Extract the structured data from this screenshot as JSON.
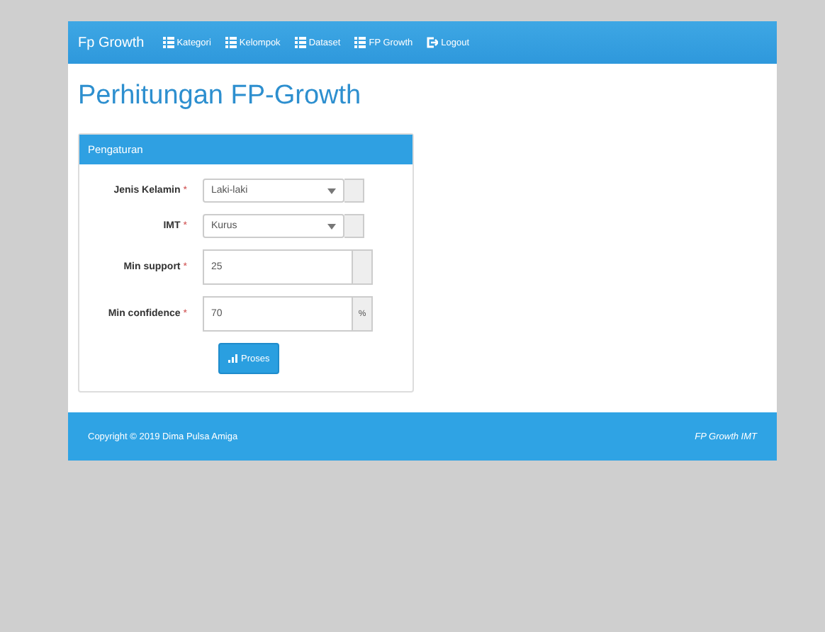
{
  "navbar": {
    "brand": "Fp Growth",
    "items": [
      {
        "label": "Kategori"
      },
      {
        "label": "Kelompok"
      },
      {
        "label": "Dataset"
      },
      {
        "label": "FP Growth"
      },
      {
        "label": "Logout",
        "kind": "logout"
      }
    ]
  },
  "page_title": "Perhitungan FP-Growth",
  "panel": {
    "title": "Pengaturan",
    "fields": [
      {
        "label": "Jenis Kelamin",
        "required": "*",
        "kind": "select",
        "value": "Laki-laki"
      },
      {
        "label": "IMT",
        "required": "*",
        "kind": "select",
        "value": "Kurus"
      },
      {
        "label": "Min support",
        "required": "*",
        "kind": "input",
        "value": "25"
      },
      {
        "label": "Min confidence",
        "required": "*",
        "kind": "input",
        "value": "70",
        "addon": "%"
      }
    ],
    "button": "Proses"
  },
  "footer": {
    "copyright": "Copyright © 2019 Dima Pulsa Amiga",
    "right": "FP Growth IMT"
  }
}
